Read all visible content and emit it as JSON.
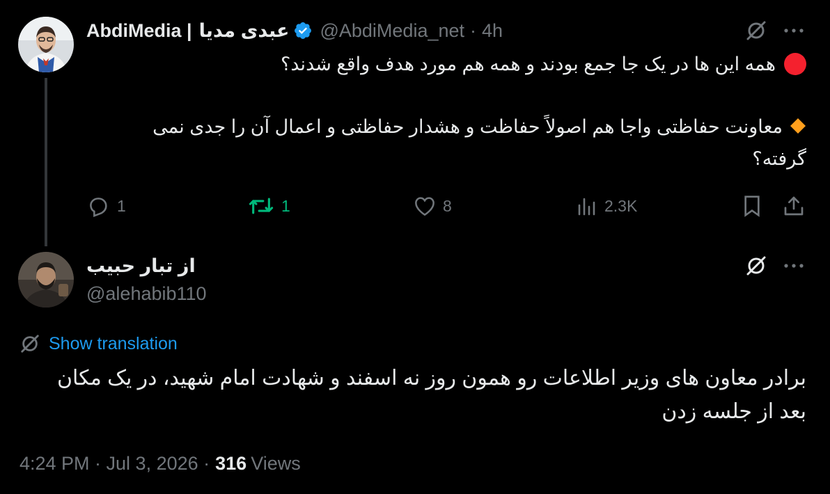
{
  "tweet1": {
    "display_name_latin": "AbdiMedia |",
    "display_name_fa": "عبدی مدیا",
    "handle": "@AbdiMedia_net",
    "separator": "·",
    "time": "4h",
    "line1": "همه این ها در یک جا جمع بودند و همه هم مورد هدف واقع شدند؟",
    "line2": "معاونت حفاظتی واجا هم اصولاً حفاظت و هشدار حفاظتی و اعمال آن را جدی نمی گرفته؟",
    "actions": {
      "replies": "1",
      "reposts": "1",
      "likes": "8",
      "views": "2.3K"
    },
    "colors": {
      "verified": "#1d9bf0",
      "repost_active": "#00ba7c",
      "red_circle": "#f4212e",
      "orange_diamond": "#ff9f1c"
    }
  },
  "tweet2": {
    "display_name": "از تبار حبیب",
    "handle": "@alehabib110",
    "show_translation": "Show translation",
    "text": "برادر معاون های وزیر اطلاعات رو همون روز نه اسفند و شهادت امام شهید، در یک مکان بعد از جلسه زدن",
    "timestamp": "4:24 PM · Jul 3, 2026 ·",
    "views_count": "316",
    "views_label": "Views",
    "colors": {
      "link": "#1d9bf0"
    }
  }
}
